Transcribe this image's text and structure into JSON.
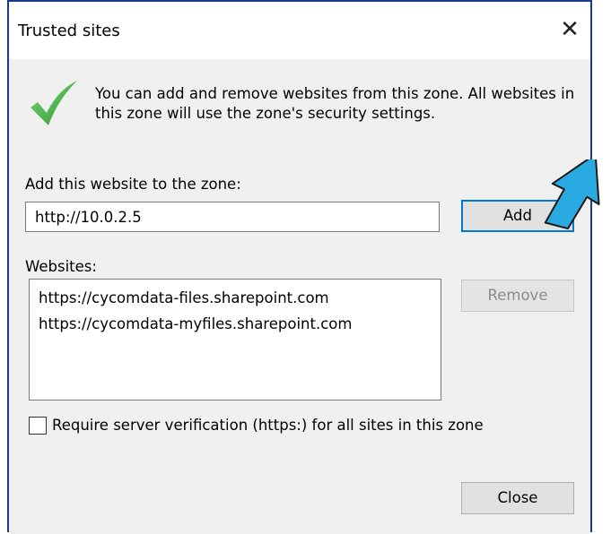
{
  "window": {
    "title": "Trusted sites",
    "close_glyph": "✕"
  },
  "info": {
    "message": "You can add and remove websites from this zone. All websites in this zone will use the zone's security settings."
  },
  "add_section": {
    "label": "Add this website to the zone:",
    "input_value": "http://10.0.2.5",
    "add_button": "Add"
  },
  "websites_section": {
    "label": "Websites:",
    "items": [
      "https://cycomdata-files.sharepoint.com",
      "https://cycomdata-myfiles.sharepoint.com"
    ],
    "remove_button": "Remove"
  },
  "verification": {
    "label": "Require server verification (https:) for all sites in this zone",
    "checked": false
  },
  "footer": {
    "close_button": "Close"
  },
  "colors": {
    "accent": "#0078d7",
    "border": "#1c3a8a",
    "callout_arrow": "#29abe2",
    "check_green": "#3dab3d"
  }
}
